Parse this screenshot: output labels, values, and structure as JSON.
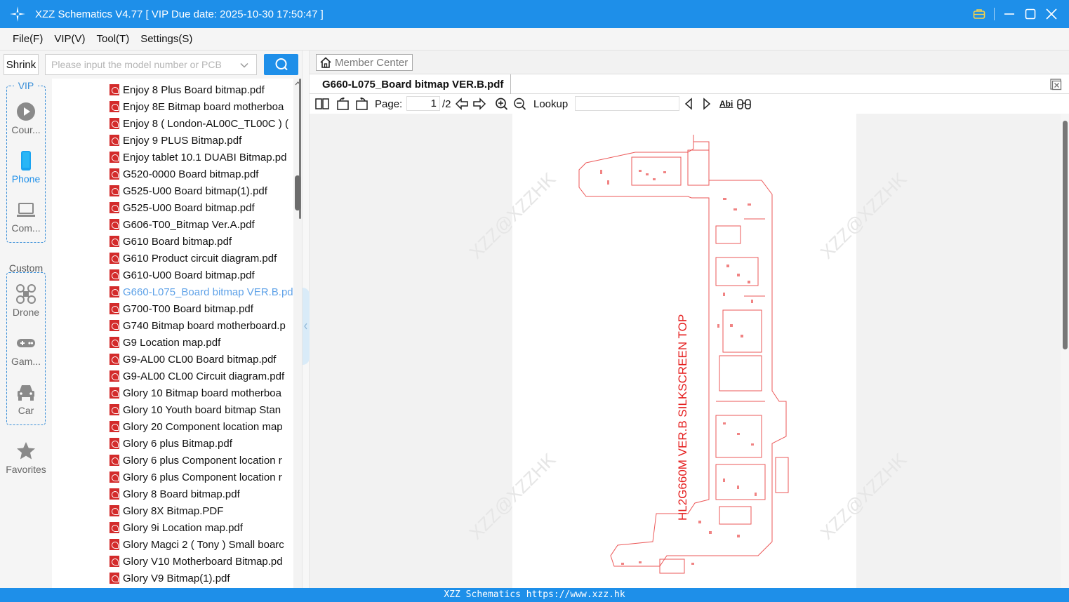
{
  "window": {
    "title": "XZZ Schematics V4.77 [ VIP Due date: 2025-10-30 17:50:47 ]"
  },
  "menu": {
    "items": [
      "File(F)",
      "VIP(V)",
      "Tool(T)",
      "Settings(S)"
    ]
  },
  "search": {
    "shrink_label": "Shrink",
    "placeholder": "Please input the model number or PCB"
  },
  "rail": {
    "vip_label": "VIP",
    "custom_label": "Custom",
    "items": [
      {
        "label": "Cour...",
        "icon": "play-circle-icon"
      },
      {
        "label": "Phone",
        "icon": "phone-icon"
      },
      {
        "label": "Com...",
        "icon": "laptop-icon"
      },
      {
        "label": "Drone",
        "icon": "drone-icon"
      },
      {
        "label": "Gam...",
        "icon": "gamepad-icon"
      },
      {
        "label": "Car",
        "icon": "car-icon"
      },
      {
        "label": "Favorites",
        "icon": "star-icon"
      }
    ]
  },
  "files": [
    "Enjoy 8 Plus Board bitmap.pdf",
    "Enjoy 8E Bitmap board motherboa",
    "Enjoy 8 ( London-AL00C_TL00C ) (",
    "Enjoy 9 PLUS Bitmap.pdf",
    "Enjoy tablet 10.1 DUABI Bitmap.pd",
    "G520-0000 Board bitmap.pdf",
    "G525-U00 Board bitmap(1).pdf",
    "G525-U00 Board bitmap.pdf",
    "G606-T00_Bitmap Ver.A.pdf",
    "G610 Board bitmap.pdf",
    "G610 Product circuit diagram.pdf",
    "G610-U00 Board bitmap.pdf",
    "G660-L075_Board bitmap VER.B.pd",
    "G700-T00 Board bitmap.pdf",
    "G740 Bitmap board motherboard.p",
    "G9 Location map.pdf",
    "G9-AL00 CL00 Board bitmap.pdf",
    "G9-AL00 CL00 Circuit diagram.pdf",
    "Glory 10 Bitmap board motherboa",
    "Glory 10 Youth board bitmap Stan",
    "Glory 20 Component location map",
    "Glory 6 plus Bitmap.pdf",
    "Glory 6 plus Component location r",
    "Glory 6 plus Component location r",
    "Glory 8 Board bitmap.pdf",
    "Glory 8X Bitmap.PDF",
    "Glory 9i Location map.pdf",
    "Glory Magci 2 ( Tony ) Small boarc",
    "Glory V10 Motherboard Bitmap.pd",
    "Glory V9 Bitmap(1).pdf"
  ],
  "selected_file_index": 12,
  "viewer": {
    "member_center": "Member Center",
    "tab_title": "G660-L075_Board bitmap VER.B.pdf",
    "page_label": "Page:",
    "page_current": "1",
    "page_total": "/2",
    "lookup_label": "Lookup",
    "abi_label": "Abi",
    "silkscreen_text": "HL2G660M VER.B SILKSCREEN TOP",
    "watermark": "XZZ@XZZHK"
  },
  "status": {
    "text": "XZZ Schematics https://www.xzz.hk"
  },
  "colors": {
    "accent": "#1e8fe9",
    "selected_text": "#5fa2e8",
    "schematic": "#e51f1f",
    "pdf_icon": "#d32b2b"
  }
}
